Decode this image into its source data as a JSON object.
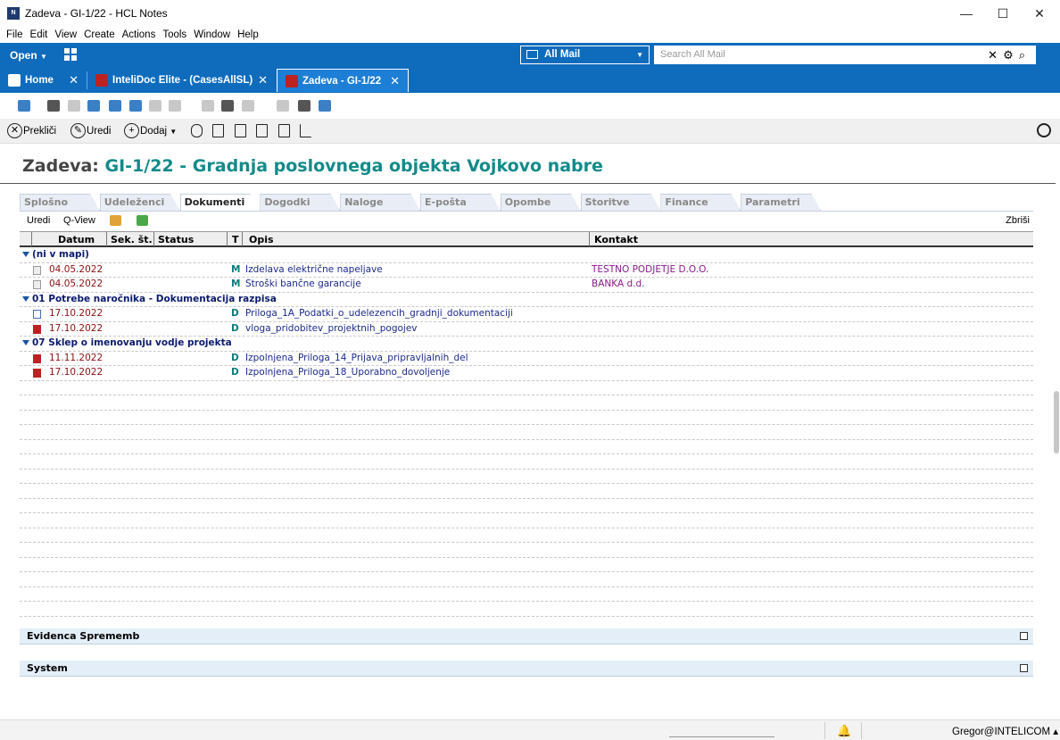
{
  "window": {
    "title": "Zadeva - GI-1/22 - HCL Notes",
    "minimize": "—",
    "maximize": "☐",
    "close": "✕"
  },
  "menu": [
    "File",
    "Edit",
    "View",
    "Create",
    "Actions",
    "Tools",
    "Window",
    "Help"
  ],
  "toolbar": {
    "open_label": "Open",
    "mail_scope": "All Mail",
    "search_placeholder": "Search All Mail"
  },
  "tabs": [
    {
      "label": "Home"
    },
    {
      "label": "InteliDoc Elite - (CasesAllSL)"
    },
    {
      "label": "Zadeva - GI-1/22"
    }
  ],
  "actions": {
    "cancel": "Prekliči",
    "edit": "Uredi",
    "add": "Dodaj"
  },
  "document": {
    "prefix": "Zadeva:",
    "name": "GI-1/22 - Gradnja poslovnega objekta Vojkovo nabre"
  },
  "section_tabs": [
    "Splošno",
    "Udeleženci",
    "Dokumenti",
    "Dogodki",
    "Naloge",
    "E-pošta",
    "Opombe",
    "Storitve",
    "Finance",
    "Parametri"
  ],
  "active_tab": "Dokumenti",
  "view_actions": {
    "edit": "Uredi",
    "qview": "Q-View",
    "delete": "Zbriši"
  },
  "columns": {
    "datum": "Datum",
    "sek": "Sek. št.",
    "status": "Status",
    "t": "T",
    "opis": "Opis",
    "kontakt": "Kontakt"
  },
  "groups": [
    {
      "title": "(ni v mapi)",
      "rows": [
        {
          "icon": "mail",
          "date": "04.05.2022",
          "t": "M",
          "opis": "Izdelava električne napeljave",
          "kontakt": "TESTNO PODJETJE D.O.O."
        },
        {
          "icon": "mail",
          "date": "04.05.2022",
          "t": "M",
          "opis": "Stroški bančne garancije",
          "kontakt": "BANKA d.d."
        }
      ]
    },
    {
      "title": "01 Potrebe naročnika - Dokumentacija razpisa",
      "rows": [
        {
          "icon": "doc",
          "date": "17.10.2022",
          "t": "D",
          "opis": "Priloga_1A_Podatki_o_udelezencih_gradnji_dokumentaciji",
          "kontakt": ""
        },
        {
          "icon": "pdf",
          "date": "17.10.2022",
          "t": "D",
          "opis": "vloga_pridobitev_projektnih_pogojev",
          "kontakt": ""
        }
      ]
    },
    {
      "title": "07 Sklep o imenovanju vodje projekta",
      "rows": [
        {
          "icon": "pdf",
          "date": "11.11.2022",
          "t": "D",
          "opis": "Izpolnjena_Priloga_14_Prijava_pripravljalnih_del",
          "kontakt": ""
        },
        {
          "icon": "pdf",
          "date": "17.10.2022",
          "t": "D",
          "opis": "Izpolnjena_Priloga_18_Uporabno_dovoljenje",
          "kontakt": ""
        }
      ]
    }
  ],
  "sections": [
    "Evidenca Sprememb",
    "System"
  ],
  "status": {
    "user": "Gregor@INTELICOM ▴"
  }
}
